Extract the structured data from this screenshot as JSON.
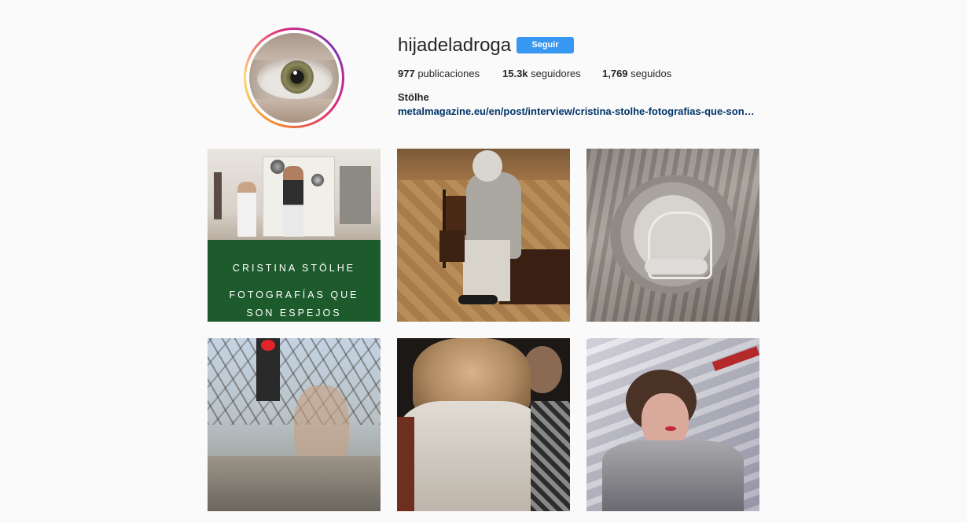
{
  "profile": {
    "username": "hijadeladroga",
    "follow_label": "Seguir",
    "stats": {
      "posts_count": "977",
      "posts_label": "publicaciones",
      "followers_count": "15.3k",
      "followers_label": "seguidores",
      "following_count": "1,769",
      "following_label": "seguidos"
    },
    "full_name": "Stölhe",
    "bio_link": "metalmagazine.eu/en/post/interview/cristina-stolhe-fotografias-que-son-espejos"
  },
  "posts": [
    {
      "banner_line1": "CRISTINA STÖLHE",
      "banner_line2": "FOTOGRAFÍAS QUE",
      "banner_line3": "SON ESPEJOS"
    }
  ],
  "colors": {
    "accent": "#3897f0",
    "link": "#003569",
    "banner_green": "#1d5b2c",
    "background": "#fafafa"
  }
}
